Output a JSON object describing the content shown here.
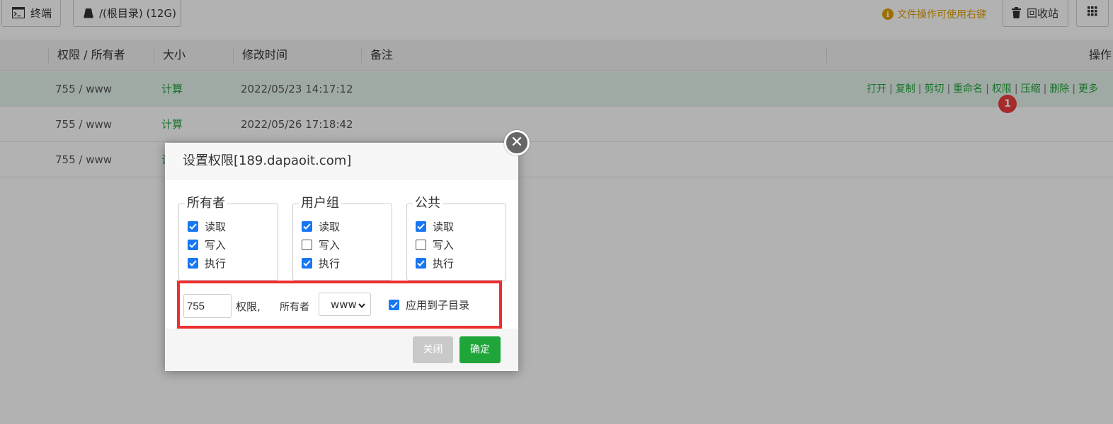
{
  "toolbar": {
    "terminal_label": "终端",
    "root_label": "/(根目录) (12G)",
    "tip_text": "文件操作可使用右键",
    "tip_icon": "info-icon",
    "recycle_label": "回收站"
  },
  "table": {
    "headers": [
      "权限 / 所有者",
      "大小",
      "修改时间",
      "备注",
      "操作"
    ],
    "rows": [
      {
        "perm": "755 / www",
        "size": "计算",
        "mtime": "2022/05/23 14:17:12"
      },
      {
        "perm": "755 / www",
        "size": "计算",
        "mtime": "2022/05/26 17:18:42"
      },
      {
        "perm": "755 / www",
        "size": "计",
        "mtime": ""
      }
    ],
    "actions": [
      "打开",
      "复制",
      "剪切",
      "重命名",
      "权限",
      "压缩",
      "删除",
      "更多"
    ],
    "badge": "1"
  },
  "dialog": {
    "title": "设置权限[189.dapaoit.com]",
    "groups": [
      {
        "legend": "所有者",
        "read": {
          "label": "读取",
          "checked": true
        },
        "write": {
          "label": "写入",
          "checked": true
        },
        "exec": {
          "label": "执行",
          "checked": true
        }
      },
      {
        "legend": "用户组",
        "read": {
          "label": "读取",
          "checked": true
        },
        "write": {
          "label": "写入",
          "checked": false
        },
        "exec": {
          "label": "执行",
          "checked": true
        }
      },
      {
        "legend": "公共",
        "read": {
          "label": "读取",
          "checked": true
        },
        "write": {
          "label": "写入",
          "checked": false
        },
        "exec": {
          "label": "执行",
          "checked": true
        }
      }
    ],
    "perm_value": "755",
    "perm_label": "权限,",
    "owner_label": "所有者",
    "owner_value": "www",
    "apply_sub_label": "应用到子目录",
    "apply_sub_checked": true,
    "close_button": "关闭",
    "ok_button": "确定"
  },
  "colors": {
    "accent_green": "#20a53a",
    "checkbox_blue": "#1877f2",
    "highlight_red": "#ee2f2f",
    "tip_orange": "#e0a100"
  }
}
